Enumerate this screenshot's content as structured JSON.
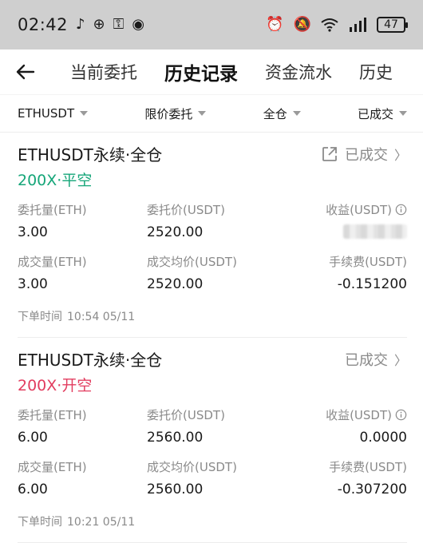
{
  "status_bar": {
    "time": "02:42",
    "battery": "47"
  },
  "tabs": [
    {
      "label": "当前委托"
    },
    {
      "label": "历史记录"
    },
    {
      "label": "资金流水"
    },
    {
      "label": "历史"
    }
  ],
  "filters": [
    {
      "label": "ETHUSDT"
    },
    {
      "label": "限价委托"
    },
    {
      "label": "全仓"
    },
    {
      "label": "已成交"
    }
  ],
  "orders": [
    {
      "title": "ETHUSDT永续·全仓",
      "side": "200X·平空",
      "side_color": "#16a679",
      "status": "已成交",
      "qty_label": "委托量(ETH)",
      "qty": "3.00",
      "price_label": "委托价(USDT)",
      "price": "2520.00",
      "pnl_label": "收益(USDT)",
      "pnl": "",
      "filled_label": "成交量(ETH)",
      "filled": "3.00",
      "avg_label": "成交均价(USDT)",
      "avg": "2520.00",
      "fee_label": "手续费(USDT)",
      "fee": "-0.151200",
      "time_label": "下单时间",
      "time": "10:54 05/11"
    },
    {
      "title": "ETHUSDT永续·全仓",
      "side": "200X·开空",
      "side_color": "#e23d5f",
      "status": "已成交",
      "qty_label": "委托量(ETH)",
      "qty": "6.00",
      "price_label": "委托价(USDT)",
      "price": "2560.00",
      "pnl_label": "收益(USDT)",
      "pnl": "0.0000",
      "filled_label": "成交量(ETH)",
      "filled": "6.00",
      "avg_label": "成交均价(USDT)",
      "avg": "2560.00",
      "fee_label": "手续费(USDT)",
      "fee": "-0.307200",
      "time_label": "下单时间",
      "time": "10:21 05/11"
    }
  ]
}
